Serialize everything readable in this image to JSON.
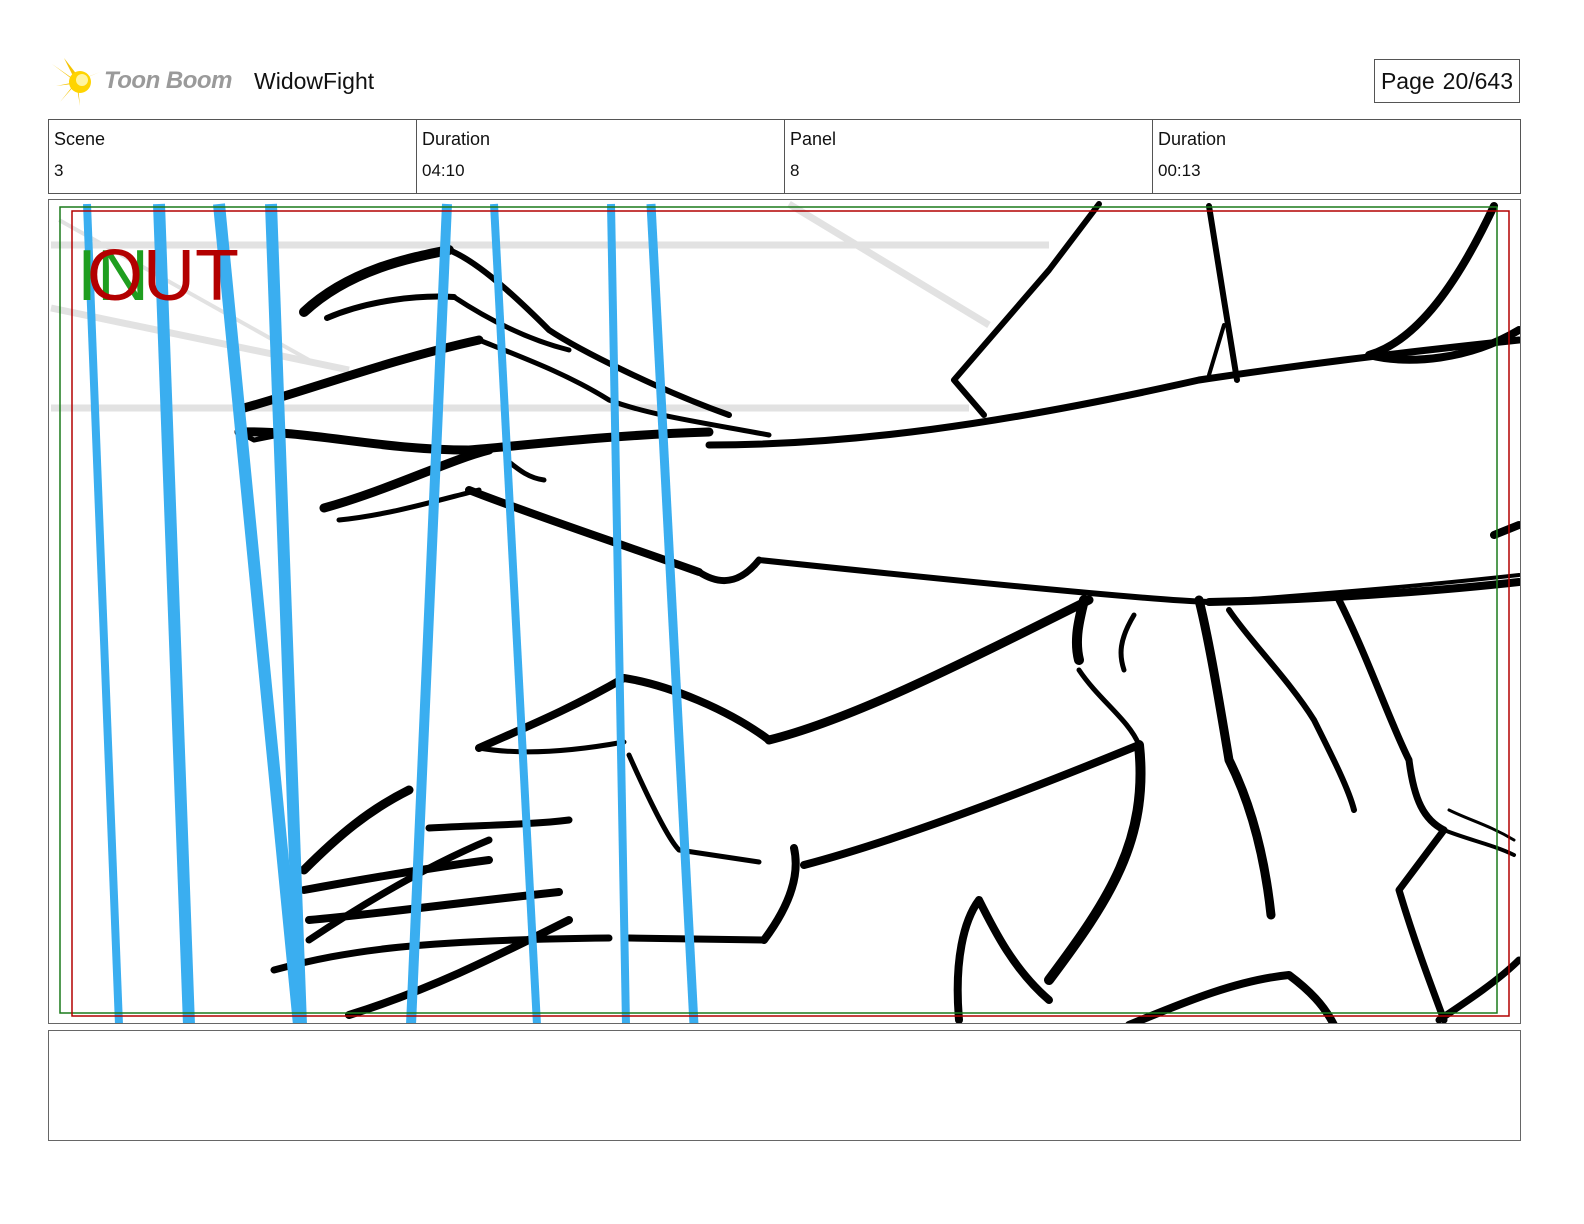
{
  "header": {
    "logo_text": "Toon Boom",
    "project_title": "WidowFight",
    "page_label": "Page",
    "page_number": "20/643"
  },
  "info": [
    {
      "label": "Scene",
      "value": "3"
    },
    {
      "label": "Duration",
      "value": "04:10"
    },
    {
      "label": "Panel",
      "value": "8"
    },
    {
      "label": "Duration",
      "value": "00:13"
    }
  ],
  "panel": {
    "in_marker": "IN",
    "out_marker": "OUT",
    "colors": {
      "in": "#1f9e1f",
      "out": "#b30000",
      "strings": "#3aaef0",
      "ink": "#000000",
      "guide": "#e2e2e2"
    }
  },
  "notes": {
    "text": ""
  }
}
